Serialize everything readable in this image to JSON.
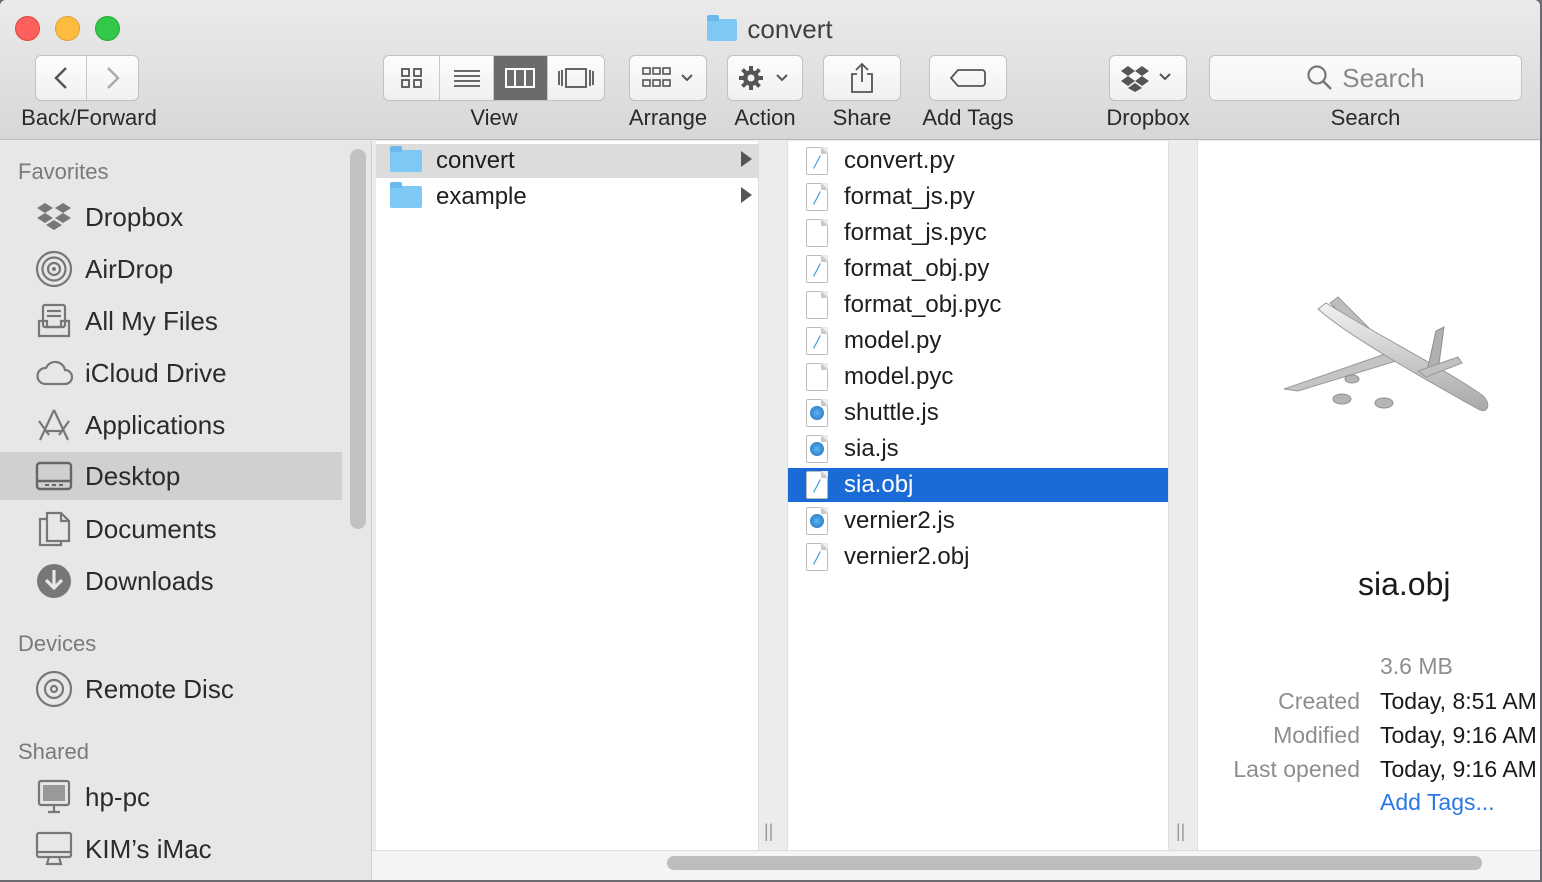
{
  "window": {
    "title": "convert"
  },
  "toolbar": {
    "back_forward_label": "Back/Forward",
    "view_label": "View",
    "arrange_label": "Arrange",
    "action_label": "Action",
    "share_label": "Share",
    "add_tags_label": "Add Tags",
    "dropbox_label": "Dropbox",
    "search_label": "Search",
    "search_placeholder": "Search",
    "active_view": "columns"
  },
  "sidebar": {
    "favorites_header": "Favorites",
    "favorites": [
      {
        "label": "Dropbox",
        "icon": "dropbox-icon"
      },
      {
        "label": "AirDrop",
        "icon": "airdrop-icon"
      },
      {
        "label": "All My Files",
        "icon": "all-files-icon"
      },
      {
        "label": "iCloud Drive",
        "icon": "cloud-icon"
      },
      {
        "label": "Applications",
        "icon": "applications-icon"
      },
      {
        "label": "Desktop",
        "icon": "desktop-icon",
        "selected": true
      },
      {
        "label": "Documents",
        "icon": "documents-icon"
      },
      {
        "label": "Downloads",
        "icon": "downloads-icon"
      }
    ],
    "devices_header": "Devices",
    "devices": [
      {
        "label": "Remote Disc",
        "icon": "disc-icon"
      }
    ],
    "shared_header": "Shared",
    "shared": [
      {
        "label": "hp-pc",
        "icon": "pc-icon"
      },
      {
        "label": "KIM’s iMac",
        "icon": "imac-icon"
      }
    ]
  },
  "column1": [
    {
      "name": "convert",
      "selected": true
    },
    {
      "name": "example",
      "selected": false
    }
  ],
  "column2": [
    {
      "name": "convert.py",
      "kind": "script"
    },
    {
      "name": "format_js.py",
      "kind": "script"
    },
    {
      "name": "format_js.pyc",
      "kind": "blank"
    },
    {
      "name": "format_obj.py",
      "kind": "script"
    },
    {
      "name": "format_obj.pyc",
      "kind": "blank"
    },
    {
      "name": "model.py",
      "kind": "script"
    },
    {
      "name": "model.pyc",
      "kind": "blank"
    },
    {
      "name": "shuttle.js",
      "kind": "js"
    },
    {
      "name": "sia.js",
      "kind": "js"
    },
    {
      "name": "sia.obj",
      "kind": "script",
      "selected": true
    },
    {
      "name": "vernier2.js",
      "kind": "js"
    },
    {
      "name": "vernier2.obj",
      "kind": "script"
    }
  ],
  "preview": {
    "name": "sia.obj",
    "size": "3.6 MB",
    "created_label": "Created",
    "created_value": "Today, 8:51 AM",
    "modified_label": "Modified",
    "modified_value": "Today, 9:16 AM",
    "opened_label": "Last opened",
    "opened_value": "Today, 9:16 AM",
    "add_tags": "Add Tags..."
  }
}
